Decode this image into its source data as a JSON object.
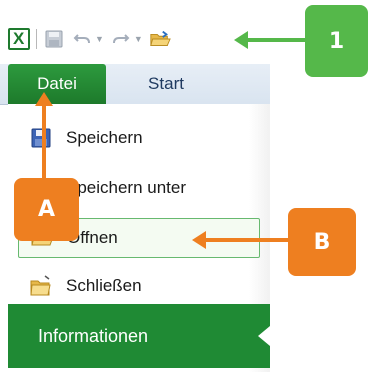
{
  "ribbon": {
    "tabs": [
      {
        "label": "Datei",
        "active": true
      },
      {
        "label": "Start",
        "active": false
      }
    ]
  },
  "backstage": {
    "items": [
      {
        "label": "Speichern",
        "icon": "floppy-disk-icon"
      },
      {
        "label": "Speichern unter",
        "icon": "save-as-icon"
      },
      {
        "label": "Öffnen",
        "icon": "open-folder-icon",
        "highlighted": true
      },
      {
        "label": "Schließen",
        "icon": "close-folder-icon"
      }
    ],
    "info_label": "Informationen"
  },
  "annotations": {
    "one": "1",
    "a": "A",
    "b": "B"
  },
  "colors": {
    "file_tab": "#1d7a2b",
    "badge_green": "#55b84a",
    "badge_orange": "#ee7f20"
  }
}
